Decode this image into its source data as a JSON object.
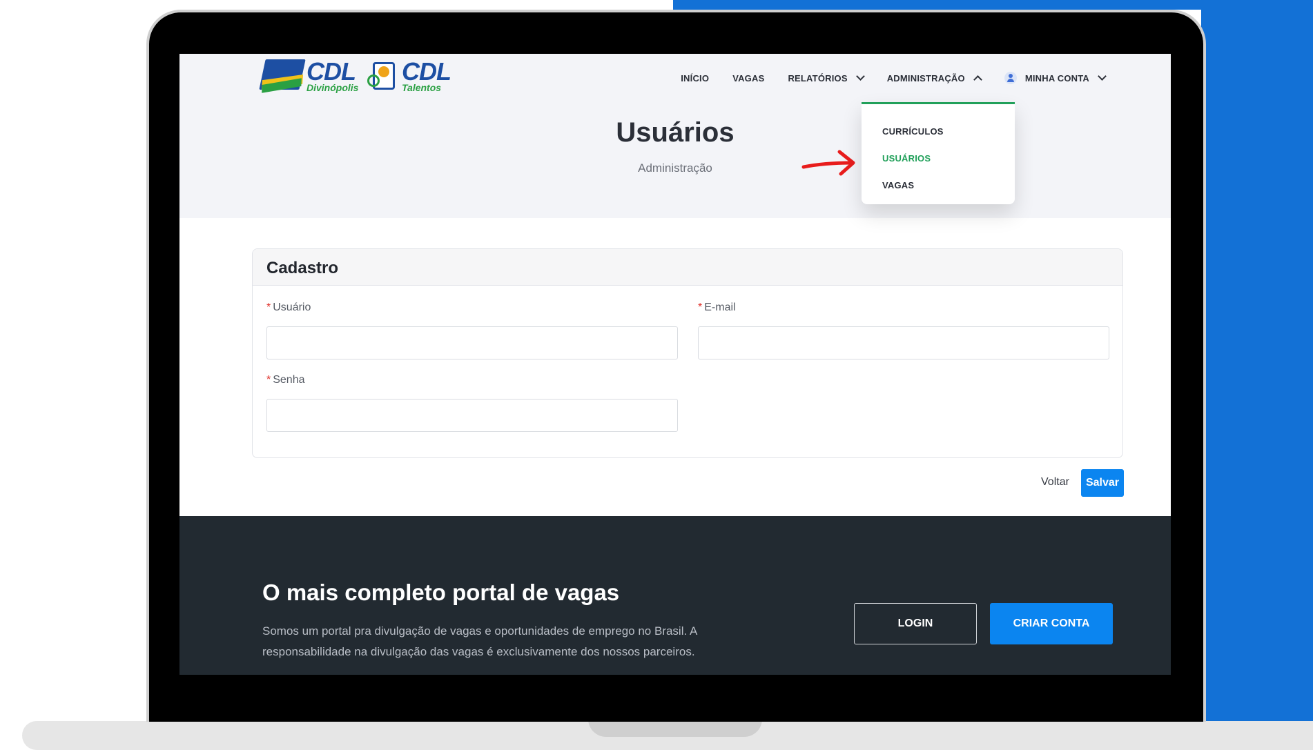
{
  "header": {
    "logos": [
      {
        "name": "CDL",
        "tagline": "Divinópolis"
      },
      {
        "name": "CDL",
        "tagline": "Talentos"
      }
    ],
    "nav": [
      {
        "label": "INÍCIO"
      },
      {
        "label": "VAGAS"
      },
      {
        "label": "RELATÓRIOS"
      },
      {
        "label": "ADMINISTRAÇÃO"
      },
      {
        "label": "MINHA CONTA"
      }
    ]
  },
  "dropdown": {
    "items": [
      {
        "label": "CURRÍCULOS"
      },
      {
        "label": "USUÁRIOS",
        "active": true
      },
      {
        "label": "VAGAS"
      }
    ],
    "accent": "#21a05a"
  },
  "page": {
    "title": "Usuários",
    "subtitle": "Administração"
  },
  "form": {
    "title": "Cadastro",
    "required_mark": "*",
    "fields": [
      {
        "label": "Usuário",
        "value": ""
      },
      {
        "label": "E-mail",
        "value": ""
      },
      {
        "label": "Senha",
        "value": ""
      }
    ],
    "back_label": "Voltar",
    "save_label": "Salvar"
  },
  "footer": {
    "title": "O mais completo portal de vagas",
    "text": "Somos um portal pra divulgação de vagas e oportunidades de emprego no Brasil. A responsabilidade na divulgação das vagas é exclusivamente dos nossos parceiros.",
    "login_label": "LOGIN",
    "create_label": "CRIAR CONTA"
  },
  "colors": {
    "primary": "#0b85f0",
    "backdrop": "#1371d6",
    "footer_bg": "#222a31"
  }
}
